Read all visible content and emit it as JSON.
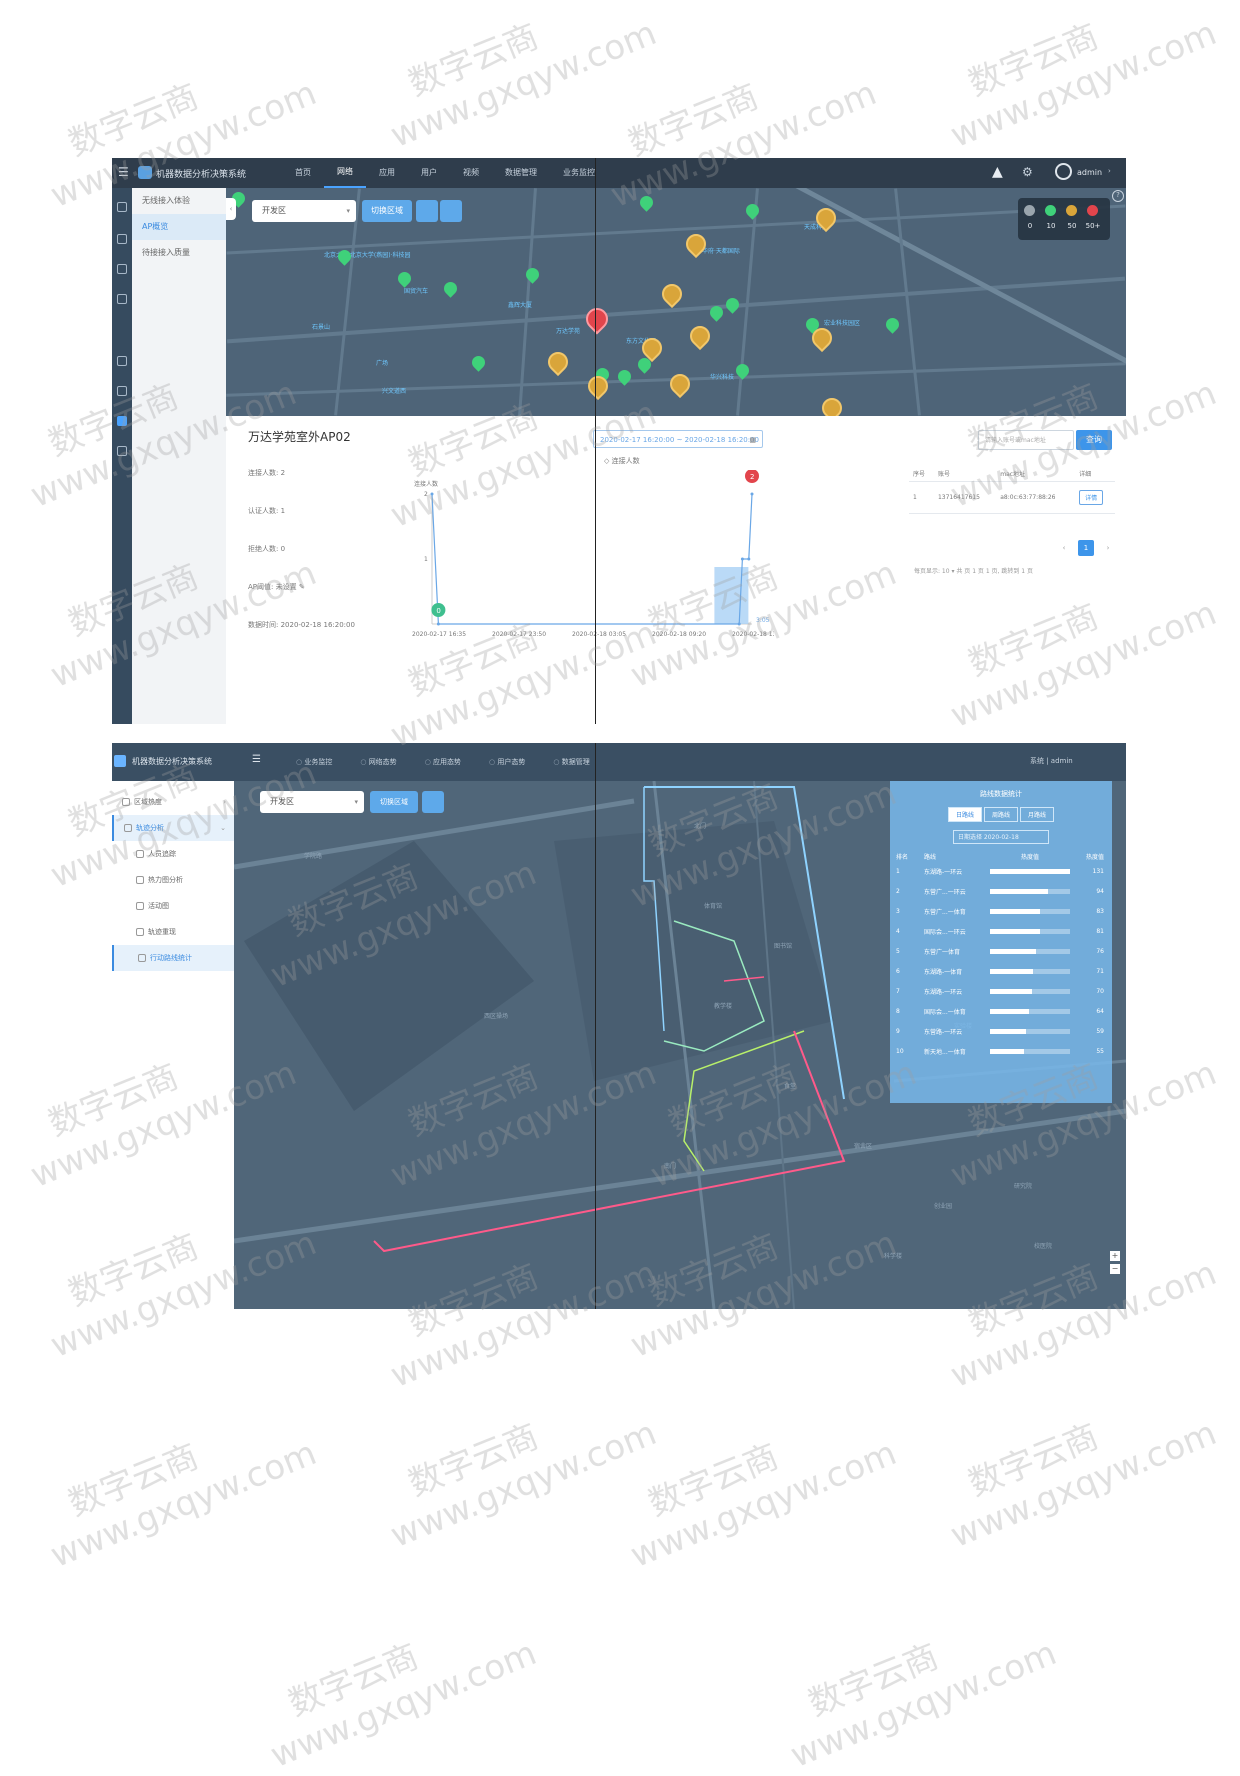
{
  "shot1": {
    "app_title": "机器数据分析决策系统",
    "nav": [
      "首页",
      "网络",
      "应用",
      "用户",
      "视频",
      "数据管理",
      "业务监控"
    ],
    "nav_active": "网络",
    "user": "admin",
    "sidebar": [
      "无线接入体验",
      "AP概览",
      "待接接入质量"
    ],
    "sidebar_active": "AP概览",
    "map": {
      "region_select": "开发区",
      "switch_btn": "切换区域",
      "legend_values": [
        "0",
        "10",
        "50",
        "50+"
      ],
      "legend_colors": [
        "#9aa5ad",
        "#3fd17a",
        "#d9a53a",
        "#e2454c"
      ],
      "labels": [
        "北京大学·北京大学(燕园)·科技园",
        "国贸汽车",
        "鑫辉大厦",
        "万达学苑",
        "东方文化园",
        "广场",
        "华兴科技",
        "石景山",
        "兴文道西",
        "天成科技",
        "华府·天都国际",
        "宏业科技园区"
      ]
    },
    "ap": {
      "title": "万达学苑室外AP02",
      "stats": [
        "连接人数: 2",
        "认证人数: 1",
        "拒绝人数: 0",
        "AP阈值: 未设置",
        "数据时间: 2020-02-18 16:20:00"
      ]
    },
    "date_range": "2020-02-17 16:20:00 ~ 2020-02-18 16:20:00",
    "series_legend": "连接人数",
    "chart_data": {
      "type": "line",
      "ylabel": "连接人数",
      "x": [
        "2020-02-17 16:35",
        "2020-02-17 23:50",
        "2020-02-18 03:05",
        "2020-02-18 09:20",
        "2020-02-18 13:35"
      ],
      "yticks": [
        1,
        2
      ],
      "ylim": [
        0,
        2
      ],
      "series": [
        {
          "name": "连接人数",
          "points": [
            [
              0,
              2
            ],
            [
              0.02,
              0
            ],
            [
              0.96,
              0
            ],
            [
              0.97,
              1
            ],
            [
              0.99,
              1
            ],
            [
              1.0,
              2
            ]
          ]
        }
      ],
      "markers": [
        {
          "label": "2",
          "color": "#e2454c"
        },
        {
          "label": "0",
          "color": "#3fbf8f"
        }
      ],
      "end_label": "3:05"
    },
    "search": {
      "placeholder": "请输入账号或mac地址",
      "button": "查询"
    },
    "table": {
      "headers": [
        "序号",
        "账号",
        "mac地址",
        "详细"
      ],
      "rows": [
        {
          "no": "1",
          "account": "13716417615",
          "mac": "a8:0c:63:77:88:26",
          "action": "详情"
        }
      ]
    },
    "pager": {
      "prev": "‹",
      "current": "1",
      "next": "›",
      "info": "每页显示: 10 ▾  共 页 1 页 1 页, 跳转到 1 页"
    }
  },
  "shot2": {
    "app_title": "机器数据分析决策系统",
    "nav": [
      "业务监控",
      "网络态势",
      "应用态势",
      "用户态势",
      "数据管理"
    ],
    "right": "系统  |  admin",
    "sidebar": [
      {
        "label": "区域热度",
        "chevron": "›",
        "sub": false,
        "active": false
      },
      {
        "label": "轨迹分析",
        "chevron": "⌄",
        "sub": false,
        "active": true
      },
      {
        "label": "人员追踪",
        "sub": true,
        "active": false
      },
      {
        "label": "热力图分析",
        "sub": true,
        "active": false
      },
      {
        "label": "活动图",
        "sub": true,
        "active": false
      },
      {
        "label": "轨迹重现",
        "sub": true,
        "active": false
      },
      {
        "label": "行动路线统计",
        "sub": true,
        "active": true
      }
    ],
    "map": {
      "region_select": "开发区",
      "switch_btn": "切换区域",
      "labels": [
        "学院路",
        "北门",
        "体育馆",
        "图书馆",
        "教学楼",
        "食堂",
        "宿舍区",
        "南门",
        "创业园",
        "研究院",
        "西区操场",
        "科学楼",
        "实验楼",
        "校医院"
      ]
    },
    "ranking": {
      "title": "路线数据统计",
      "tabs": [
        "日路线",
        "周路线",
        "月路线"
      ],
      "active_tab": "日路线",
      "date": "日期选择 2020-02-18",
      "headers": [
        "排名",
        "路线",
        "热度值",
        "热度值"
      ],
      "rows": [
        {
          "no": "1",
          "name": "东湖路-一环云",
          "value": "131",
          "pct": 100
        },
        {
          "no": "2",
          "name": "东营广...一环云",
          "value": "94",
          "pct": 72
        },
        {
          "no": "3",
          "name": "东营广...一体育",
          "value": "83",
          "pct": 63
        },
        {
          "no": "4",
          "name": "国际会...一环云",
          "value": "81",
          "pct": 62
        },
        {
          "no": "5",
          "name": "东营广一体育",
          "value": "76",
          "pct": 58
        },
        {
          "no": "6",
          "name": "东湖路-一体育",
          "value": "71",
          "pct": 54
        },
        {
          "no": "7",
          "name": "东湖路-一环云",
          "value": "70",
          "pct": 53
        },
        {
          "no": "8",
          "name": "国际会...一体育",
          "value": "64",
          "pct": 49
        },
        {
          "no": "9",
          "name": "东营路-一环云",
          "value": "59",
          "pct": 45
        },
        {
          "no": "10",
          "name": "新天地...一体育",
          "value": "55",
          "pct": 42
        }
      ]
    },
    "zoom": [
      "+",
      "−"
    ]
  },
  "watermark": {
    "cn": "数字云商",
    "url": "www.gxqyw.com"
  }
}
